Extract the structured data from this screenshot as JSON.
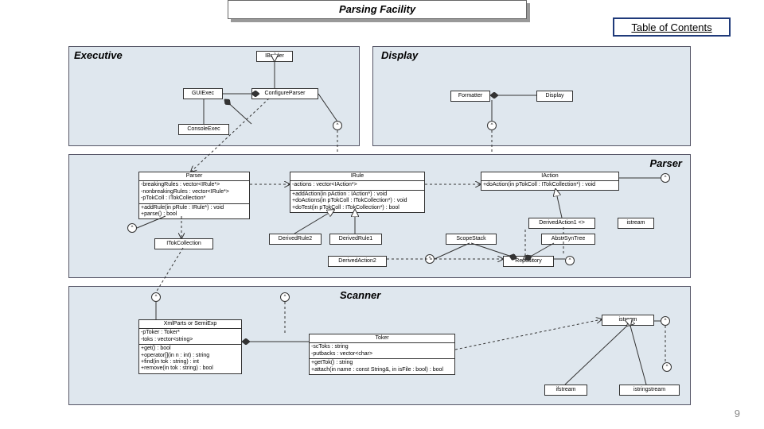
{
  "title": "Parsing Facility",
  "toc": "Table of Contents",
  "page_number": "9",
  "packages": {
    "executive": {
      "label": "Executive"
    },
    "display": {
      "label": "Display"
    },
    "parser": {
      "label": "Parser"
    },
    "scanner": {
      "label": "Scanner"
    }
  },
  "classes": {
    "ibuilder": {
      "name": "IBuilder"
    },
    "guiexec": {
      "name": "GUIExec"
    },
    "configureparser": {
      "name": "ConfigureParser"
    },
    "consoleexec": {
      "name": "ConsoleExec"
    },
    "formatter": {
      "name": "Formatter"
    },
    "display2": {
      "name": "Display"
    },
    "parser": {
      "name": "Parser",
      "attrs": "-breakingRules : vector<IRule*>\n-nonbreakingRules : vector<IRule*>\n-pTokColl : ITokCollection*",
      "ops": "+addRule(in pRule : IRule*) : void\n+parse() : bool"
    },
    "irule": {
      "name": "IRule",
      "attrs": "-actions : vector<IAction*>",
      "ops": "+addAction(in pAction : IAction*) : void\n+doActions(in pTokColl : ITokCollection*) : void\n+doTest(in pTokColl : ITokCollection*) : bool"
    },
    "iaction": {
      "name": "IAction",
      "ops": "+doAction(in pTokColl : ITokCollection*) : void"
    },
    "derivedaction1": {
      "name": "DerivedAction1 <>"
    },
    "istream": {
      "name": "istream"
    },
    "itokcollection": {
      "name": "ITokCollection"
    },
    "derivedrule2": {
      "name": "DerivedRule2"
    },
    "derivedrule1": {
      "name": "DerivedRule1"
    },
    "scopestack": {
      "name": "ScopeStack"
    },
    "abstrsyntree": {
      "name": "AbstrSynTree"
    },
    "derivedaction2": {
      "name": "DerivedAction2"
    },
    "repository": {
      "name": "Repository"
    },
    "xmlparts": {
      "name": "XmlParts or SemiExp",
      "attrs": "-pToker : Toker*\n-toks : vector<string>",
      "ops": "+get() : bool\n+operator[](in n : int) : string\n+find(in tok : string) : int\n+remove(in tok : string) : bool"
    },
    "toker": {
      "name": "Toker",
      "attrs": "-scToks : string\n-putbacks : vector<char>",
      "ops": "+getTok() : string\n+attach(in name : const String&, in isFile : bool) : bool"
    },
    "istream2": {
      "name": "istream"
    },
    "ifstream": {
      "name": "ifstream"
    },
    "istringstream": {
      "name": "istringstream"
    }
  },
  "lollipop_char": "^"
}
